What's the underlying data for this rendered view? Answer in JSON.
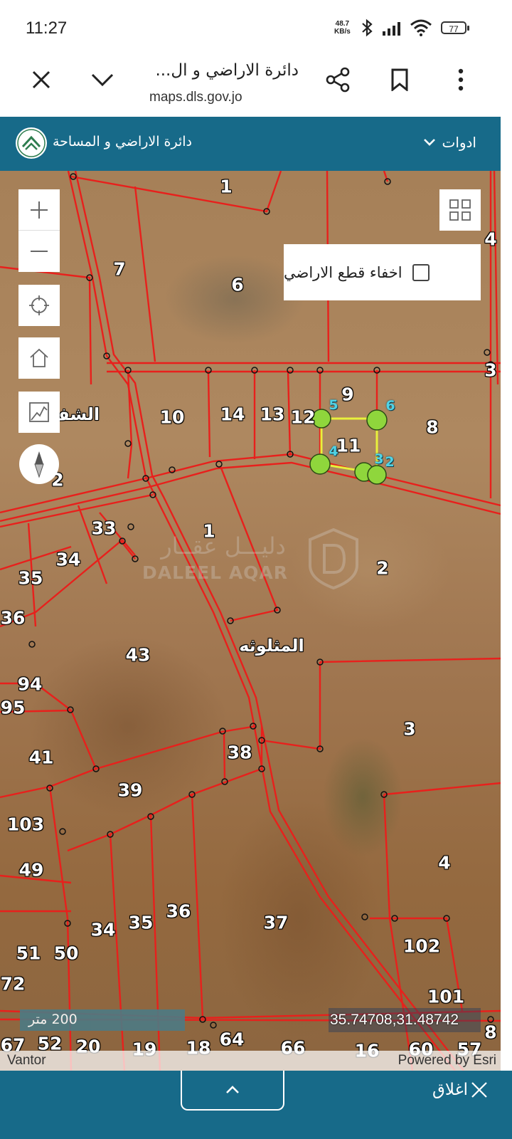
{
  "status_bar": {
    "time": "11:27",
    "net_speed_value": "48.7",
    "net_speed_unit": "KB/s",
    "battery": "77",
    "icons": [
      "bluetooth-icon",
      "signal-icon",
      "wifi-icon",
      "battery-icon"
    ]
  },
  "browser": {
    "page_title": "دائرة الاراضي و ال...",
    "url": "maps.dls.gov.jo",
    "buttons": [
      "close-icon",
      "chevron-down-icon",
      "share-icon",
      "bookmark-icon",
      "more-vert-icon"
    ]
  },
  "app_header": {
    "title": "دائرة الاراضي و المساحة",
    "tools_label": "ادوات",
    "brand_color": "#176a89"
  },
  "map": {
    "hide_parcels_label": "اخفاء قطع الاراضي",
    "hide_parcels_checked": false,
    "scale_label": "200 متر",
    "coordinates": "35.74708,31.48742",
    "attribution_left": "Vantor",
    "attribution_right": "Powered by Esri",
    "watermark_ar": "دليـــل عقــار",
    "watermark_en": "DALEEL AQAR",
    "parcel_color": "#e8201c",
    "selection_color": "#e8f03c",
    "vertex_color": "#8fd63c",
    "place_labels": {
      "west": "الشف",
      "center": "المثلوثه"
    },
    "parcels_top": [
      "1",
      "7",
      "6",
      "4",
      "3",
      "10",
      "14",
      "13",
      "12",
      "9",
      "11",
      "8",
      "2"
    ],
    "parcels_mid": [
      "33",
      "34",
      "35",
      "36",
      "1",
      "2",
      "43",
      "94",
      "95",
      "3",
      "41",
      "38",
      "39"
    ],
    "parcels_low": [
      "103",
      "49",
      "4",
      "34",
      "35",
      "36",
      "37",
      "51",
      "50",
      "102",
      "72",
      "101"
    ],
    "parcels_bottom": [
      "67",
      "52",
      "20",
      "19",
      "18",
      "64",
      "66",
      "16",
      "60",
      "57",
      "8"
    ],
    "vertices": [
      "5",
      "6",
      "4",
      "3",
      "2"
    ]
  },
  "bottom_bar": {
    "close_label": "اغلاق"
  }
}
